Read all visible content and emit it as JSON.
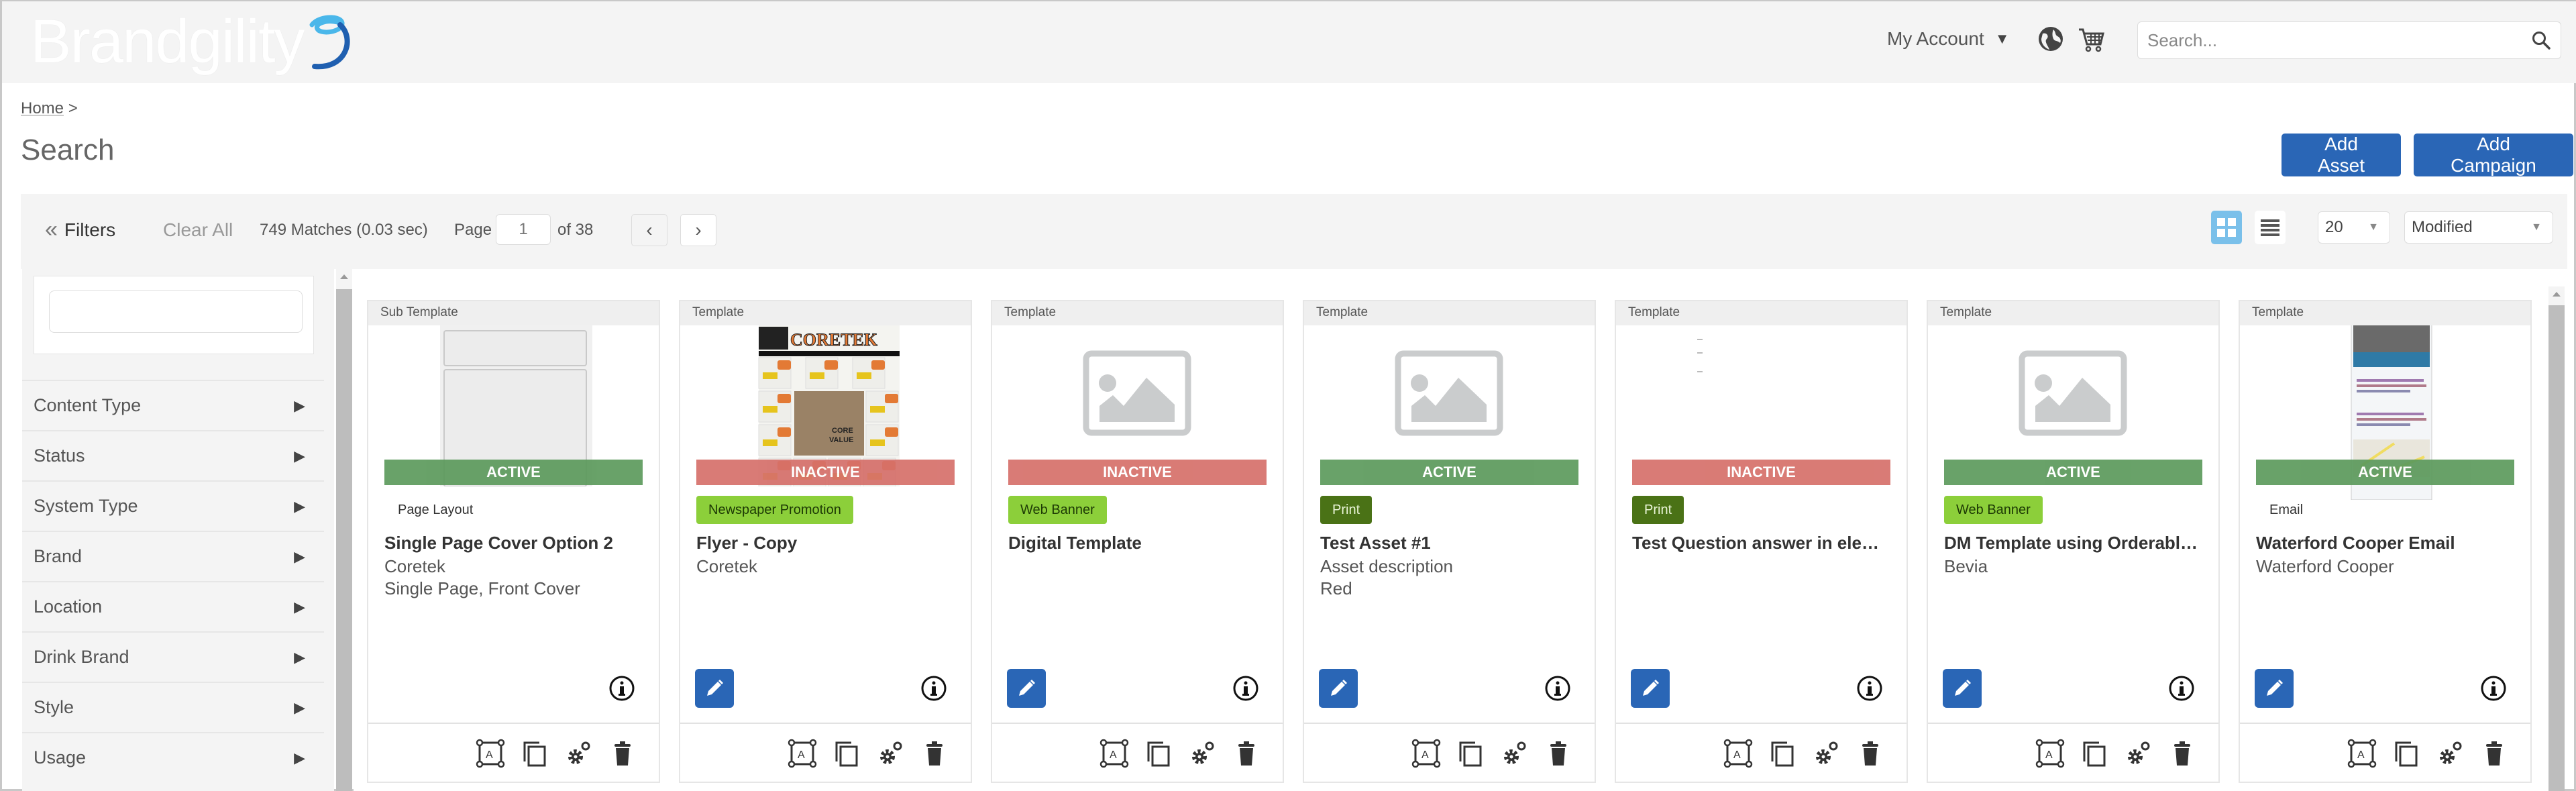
{
  "header": {
    "logo_text": "Brandgility",
    "account_label": "My Account",
    "account_caret": "▼",
    "globe_icon": "globe-icon",
    "cart_icon": "shopping-cart-icon",
    "search_placeholder": "Search...",
    "search_value": ""
  },
  "breadcrumb": {
    "home": "Home",
    "separator": ">"
  },
  "page": {
    "title": "Search",
    "add_asset_label": "Add Asset",
    "add_campaign_label": "Add Campaign"
  },
  "toolbar": {
    "filters_chevron": "«",
    "filters_label": "Filters",
    "clear_all_label": "Clear All",
    "matches_text": "749 Matches (0.03 sec)",
    "page_label": "Page",
    "page_value": "1",
    "page_of": "of 38",
    "prev_label": "‹",
    "next_label": "›",
    "per_page_value": "20",
    "sort_value": "Modified",
    "select_arrow": "▼",
    "active_view": "grid"
  },
  "filters": {
    "search_value": "",
    "items": [
      {
        "label": "Content Type"
      },
      {
        "label": "Status"
      },
      {
        "label": "System Type"
      },
      {
        "label": "Brand"
      },
      {
        "label": "Location"
      },
      {
        "label": "Drink Brand"
      },
      {
        "label": "Style"
      },
      {
        "label": "Usage"
      }
    ],
    "expand_glyph": "▶"
  },
  "cards": [
    {
      "type": "Sub Template",
      "thumb": "page-layout-preview",
      "status": "ACTIVE",
      "tag": "Page Layout",
      "tag_style": "plain",
      "title": "Single Page Cover Option 2",
      "lines": [
        "Coretek",
        "Single Page, Front Cover"
      ],
      "editable": false
    },
    {
      "type": "Template",
      "thumb": "coretek-flyer-preview",
      "thumb_text": "CORETEK",
      "status": "INACTIVE",
      "tag": "Newspaper Promotion",
      "tag_style": "light",
      "title": "Flyer - Copy",
      "lines": [
        "Coretek"
      ],
      "editable": true
    },
    {
      "type": "Template",
      "thumb": "image-placeholder",
      "status": "INACTIVE",
      "tag": "Web Banner",
      "tag_style": "light",
      "title": "Digital Template",
      "lines": [],
      "editable": true
    },
    {
      "type": "Template",
      "thumb": "image-placeholder",
      "status": "ACTIVE",
      "tag": "Print",
      "tag_style": "dark",
      "title": "Test Asset #1",
      "lines": [
        "Asset description",
        "Red"
      ],
      "editable": true
    },
    {
      "type": "Template",
      "thumb": "blank-preview",
      "status": "INACTIVE",
      "tag": "Print",
      "tag_style": "dark",
      "title": "Test Question answer in eleme...",
      "lines": [],
      "editable": true
    },
    {
      "type": "Template",
      "thumb": "image-placeholder",
      "status": "ACTIVE",
      "tag": "Web Banner",
      "tag_style": "light",
      "title": "DM Template using Orderable I...",
      "lines": [
        "Bevia"
      ],
      "editable": true
    },
    {
      "type": "Template",
      "thumb": "email-preview",
      "status": "ACTIVE",
      "tag": "Email",
      "tag_style": "plain",
      "title": "Waterford Cooper Email",
      "lines": [
        "Waterford Cooper"
      ],
      "editable": true
    }
  ],
  "colors": {
    "primary": "#2a66b6",
    "active": "#5c9a5c",
    "inactive": "#d6706a",
    "tag_light": "#8ccf3a",
    "tag_dark": "#4a7216",
    "grid_view_active": "#7ac0ea"
  }
}
